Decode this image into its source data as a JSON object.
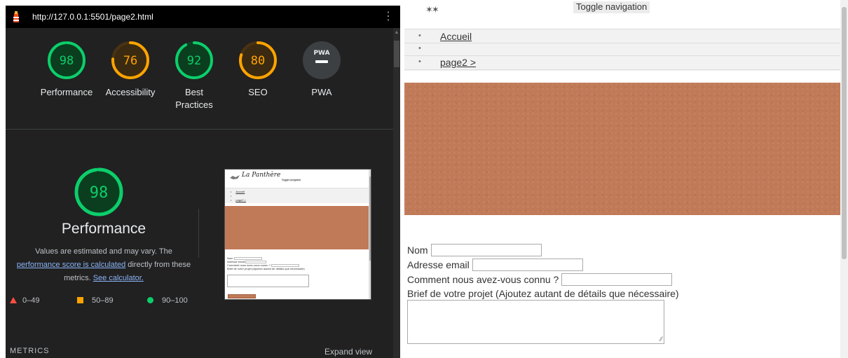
{
  "lighthouse": {
    "url": "http://127.0.0.1:5501/page2.html",
    "categories": [
      {
        "score": "98",
        "label": "Performance",
        "color": "#0cce6b"
      },
      {
        "score": "76",
        "label": "Accessibility",
        "color": "#ffa400"
      },
      {
        "score": "92",
        "label": "Best Practices",
        "color": "#0cce6b"
      },
      {
        "score": "80",
        "label": "SEO",
        "color": "#ffa400"
      },
      {
        "score": "PWA",
        "label": "PWA",
        "color": "#9aa0a6"
      }
    ],
    "performance": {
      "score": "98",
      "title": "Performance",
      "desc_1": "Values are estimated and may vary. The",
      "desc_link_1": "performance score is calculated",
      "desc_2": " directly from these",
      "desc_3": "metrics. ",
      "desc_link_2": "See calculator."
    },
    "legend": {
      "fail": "0–49",
      "average": "50–89",
      "pass": "90–100"
    },
    "metrics_heading": "METRICS",
    "expand_view": "Expand view",
    "thumbnail": {
      "brand": "La Panthère",
      "toggle": "Toggle navigation",
      "nav_1": "Accueil",
      "nav_2": "page2 >",
      "form_nom": "Nom",
      "form_email": "Adresse email",
      "form_connu": "Comment nous avez-vous connu ?",
      "form_brief": "Brief de votre projet (Ajoutez autant de détails que nécessaire)"
    }
  },
  "page": {
    "toggle_nav": "Toggle navigation",
    "nav": [
      {
        "label": "Accueil"
      },
      {
        "label": ""
      },
      {
        "label": "page2 >"
      }
    ],
    "banner_color": "#c17a58",
    "form": {
      "nom_label": "Nom",
      "email_label": "Adresse email",
      "connu_label": "Comment nous avez-vous connu ?",
      "brief_label": "Brief de votre projet (Ajoutez autant de détails que nécessaire)"
    }
  }
}
